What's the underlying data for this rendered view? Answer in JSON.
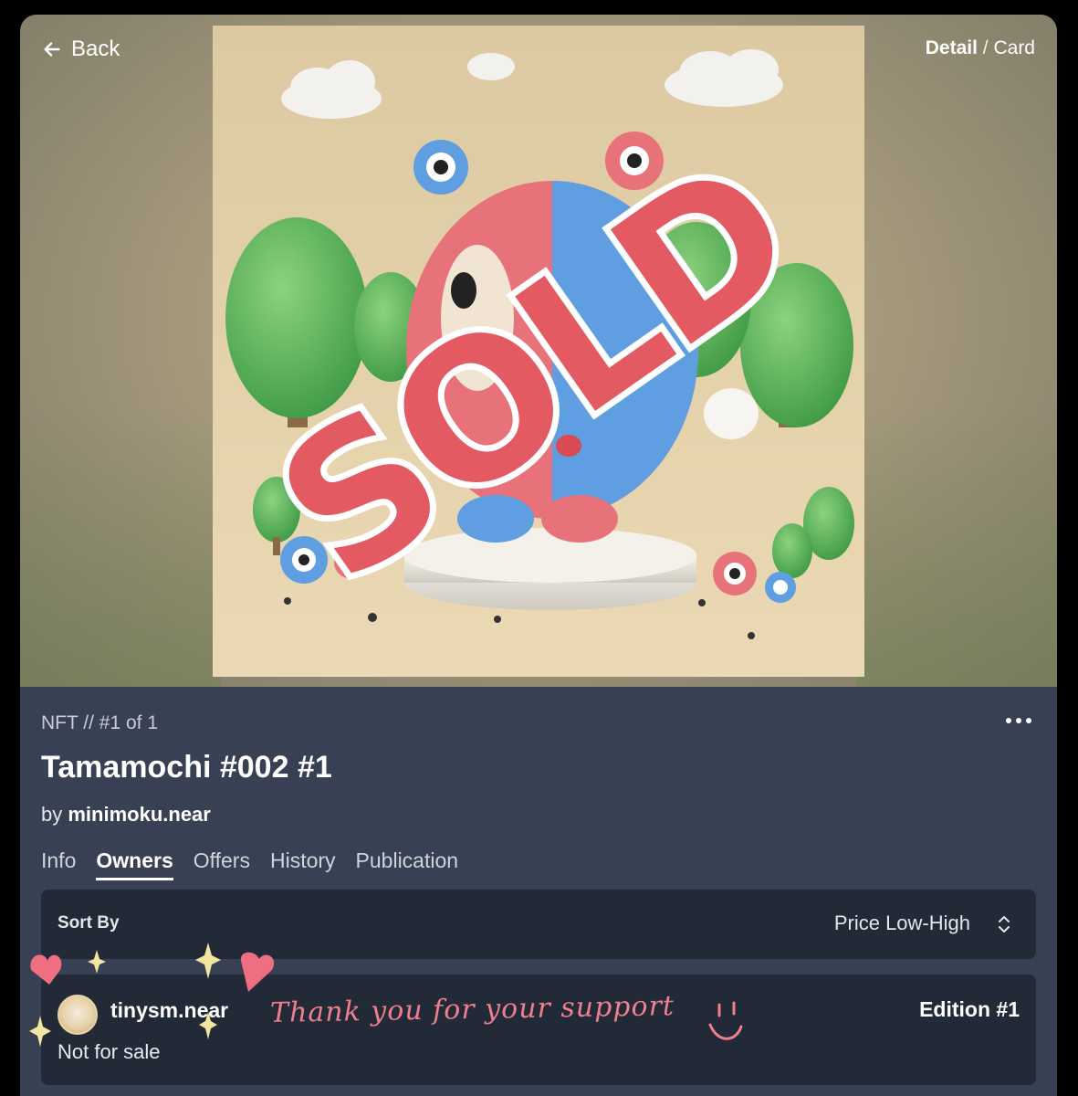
{
  "nav": {
    "back_label": "Back",
    "view_active": "Detail",
    "view_separator": "/",
    "view_other": "Card"
  },
  "artwork": {
    "overlay_text": "SOLD",
    "colors": {
      "background": "#e4cfa3",
      "tree": "#5cb25a",
      "character_red": "#e6707a",
      "character_blue": "#5f9ee0",
      "stamp": "#e35a63"
    }
  },
  "token": {
    "breadcrumb": "NFT // #1 of 1",
    "title": "Tamamochi #002 #1",
    "by_prefix": "by",
    "creator": "minimoku.near"
  },
  "tabs": [
    {
      "label": "Info",
      "active": false
    },
    {
      "label": "Owners",
      "active": true
    },
    {
      "label": "Offers",
      "active": false
    },
    {
      "label": "History",
      "active": false
    },
    {
      "label": "Publication",
      "active": false
    }
  ],
  "sort": {
    "label": "Sort By",
    "value": "Price Low-High"
  },
  "owners": [
    {
      "name": "tinysm.near",
      "status": "Not for sale",
      "edition": "Edition #1"
    }
  ],
  "annotation": {
    "text": "Thank you for your support",
    "color": "#ef7f8f",
    "heart_color": "#ef6f82",
    "sparkle_color": "#f3e6a0"
  }
}
